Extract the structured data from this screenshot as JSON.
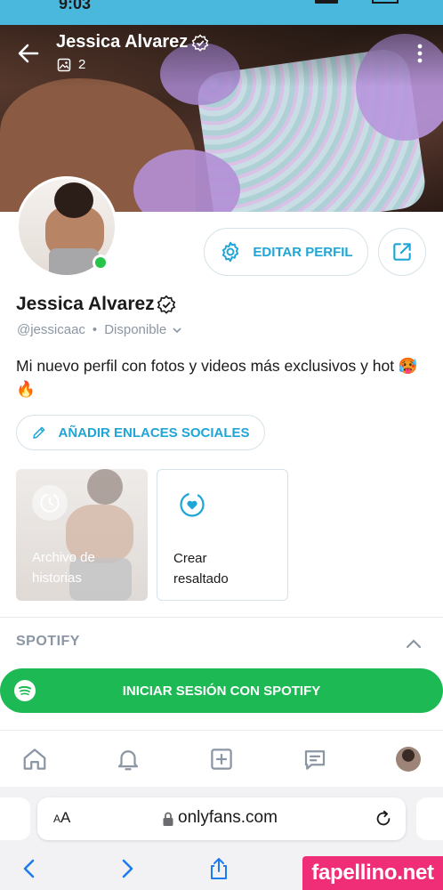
{
  "status_bar": {
    "time": "9:03"
  },
  "header": {
    "name": "Jessica Alvarez",
    "media_count": "2",
    "icons": {
      "back": "arrow-left-icon",
      "media": "image-icon",
      "more": "more-vertical-icon",
      "verified": "verified-badge-icon"
    }
  },
  "profile": {
    "name": "Jessica Alvarez",
    "handle": "@jessicaac",
    "separator": "•",
    "status": "Disponible",
    "bio": "Mi nuevo perfil con fotos y videos más exclusivos y hot 🥵🔥",
    "online": true
  },
  "actions": {
    "edit_profile": "EDITAR PERFIL",
    "add_social_links": "AÑADIR ENLACES SOCIALES"
  },
  "highlights": [
    {
      "label": "Archivo de historias",
      "icon": "history-icon"
    },
    {
      "label": "Crear resaltado",
      "icon": "heart-circle-icon"
    }
  ],
  "spotify": {
    "title": "SPOTIFY",
    "login_label": "INICIAR SESIÓN CON SPOTIFY",
    "brand_color": "#1db954"
  },
  "bottom_nav": {
    "items": [
      "home-icon",
      "bell-icon",
      "plus-square-icon",
      "messages-icon",
      "profile-avatar"
    ]
  },
  "browser": {
    "aa_label": "AA",
    "url": "onlyfans.com",
    "toolbar": [
      "back-icon",
      "forward-icon",
      "share-icon",
      "bookmarks-icon",
      "tabs-icon"
    ]
  },
  "watermark": "fapellino.net",
  "colors": {
    "accent": "#1fa5d6",
    "muted": "#8a96a3",
    "online": "#26c54a",
    "watermark_bg": "#ef2e77"
  }
}
